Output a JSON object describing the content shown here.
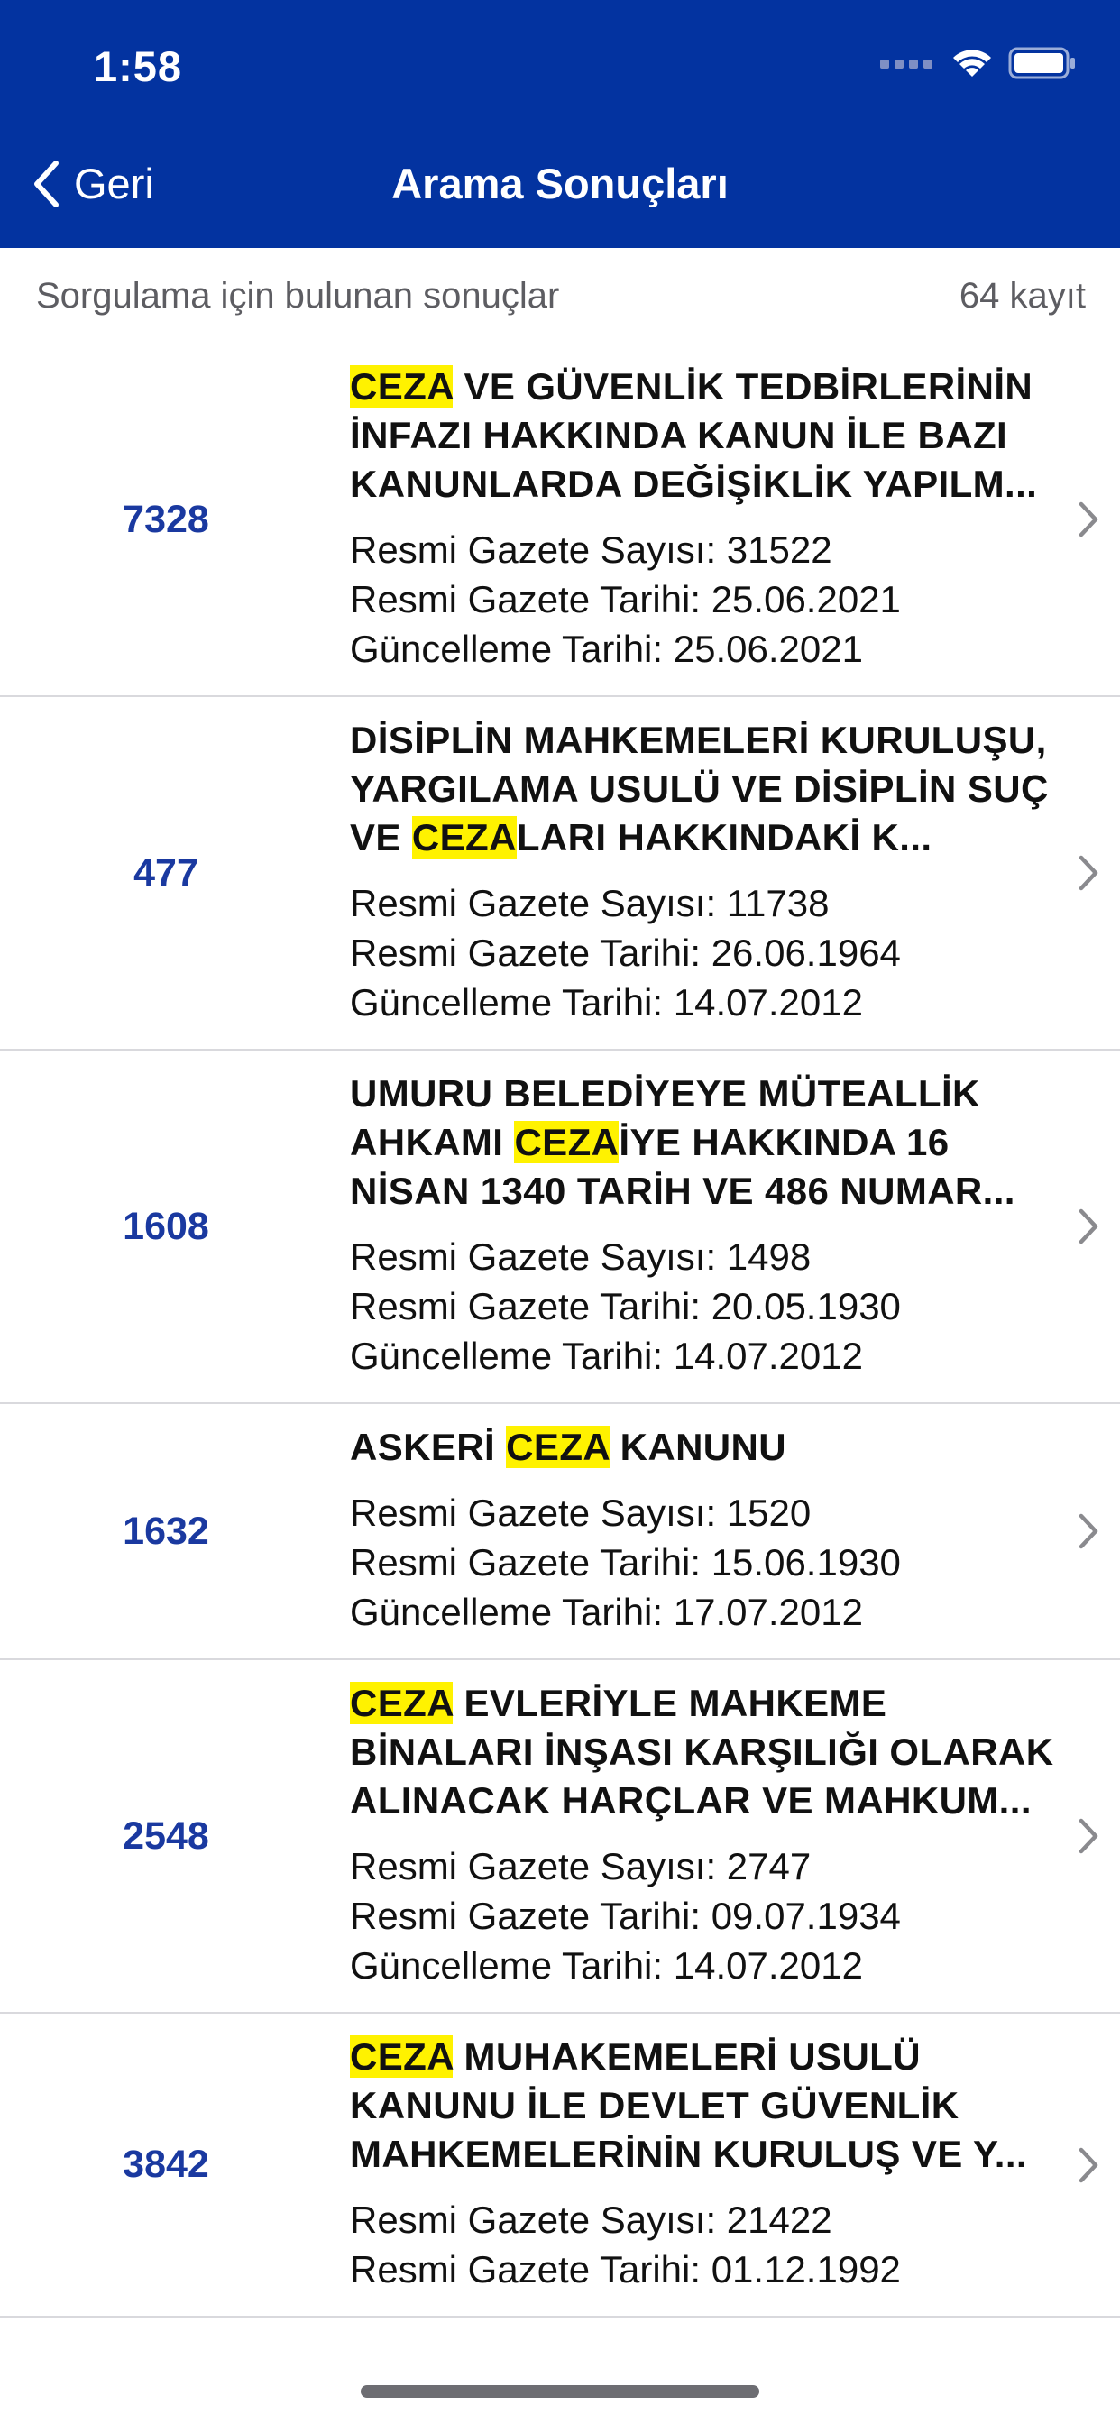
{
  "status": {
    "time": "1:58"
  },
  "nav": {
    "back_label": "Geri",
    "title": "Arama Sonuçları"
  },
  "summary": {
    "label": "Sorgulama için bulunan sonuçlar",
    "count": "64 kayıt"
  },
  "colors": {
    "header_bg": "#0333a0",
    "highlight": "#fff200",
    "number": "#1a39a0"
  },
  "results": [
    {
      "number": "7328",
      "title_pre": "",
      "title_hl": "CEZA",
      "title_post": " VE GÜVENLİK TEDBİRLERİNİN İNFAZI HAKKINDA KANUN İLE BAZI KANUNLARDA DEĞİŞİKLİK YAPILM...",
      "gazete_sayisi": "Resmi Gazete Sayısı: 31522",
      "gazete_tarihi": "Resmi Gazete Tarihi: 25.06.2021",
      "guncelleme": "Güncelleme Tarihi: 25.06.2021"
    },
    {
      "number": "477",
      "title_pre": "DİSİPLİN MAHKEMELERİ KURULUŞU, YARGILAMA USULÜ VE DİSİPLİN SUÇ VE ",
      "title_hl": "CEZA",
      "title_post": "LARI HAKKINDAKİ K...",
      "gazete_sayisi": "Resmi Gazete Sayısı: 11738",
      "gazete_tarihi": "Resmi Gazete Tarihi: 26.06.1964",
      "guncelleme": "Güncelleme Tarihi: 14.07.2012"
    },
    {
      "number": "1608",
      "title_pre": "UMURU BELEDİYEYE MÜTEALLİK AHKAMI ",
      "title_hl": "CEZA",
      "title_post": "İYE HAKKINDA 16 NİSAN 1340 TARİH VE 486 NUMAR...",
      "gazete_sayisi": "Resmi Gazete Sayısı: 1498",
      "gazete_tarihi": "Resmi Gazete Tarihi: 20.05.1930",
      "guncelleme": "Güncelleme Tarihi: 14.07.2012"
    },
    {
      "number": "1632",
      "title_pre": "ASKERİ ",
      "title_hl": "CEZA",
      "title_post": " KANUNU",
      "gazete_sayisi": "Resmi Gazete Sayısı: 1520",
      "gazete_tarihi": "Resmi Gazete Tarihi: 15.06.1930",
      "guncelleme": "Güncelleme Tarihi: 17.07.2012"
    },
    {
      "number": "2548",
      "title_pre": "",
      "title_hl": "CEZA",
      "title_post": " EVLERİYLE MAHKEME BİNALARI İNŞASI KARŞILIĞI OLARAK ALINACAK HARÇLAR VE MAHKUM...",
      "gazete_sayisi": "Resmi Gazete Sayısı: 2747",
      "gazete_tarihi": "Resmi Gazete Tarihi: 09.07.1934",
      "guncelleme": "Güncelleme Tarihi: 14.07.2012"
    },
    {
      "number": "3842",
      "title_pre": "",
      "title_hl": "CEZA",
      "title_post": " MUHAKEMELERİ USULÜ KANUNU İLE DEVLET GÜVENLİK MAHKEMELERİNİN KURULUŞ VE Y...",
      "gazete_sayisi": "Resmi Gazete Sayısı: 21422",
      "gazete_tarihi": "Resmi Gazete Tarihi: 01.12.1992",
      "guncelleme": ""
    }
  ]
}
